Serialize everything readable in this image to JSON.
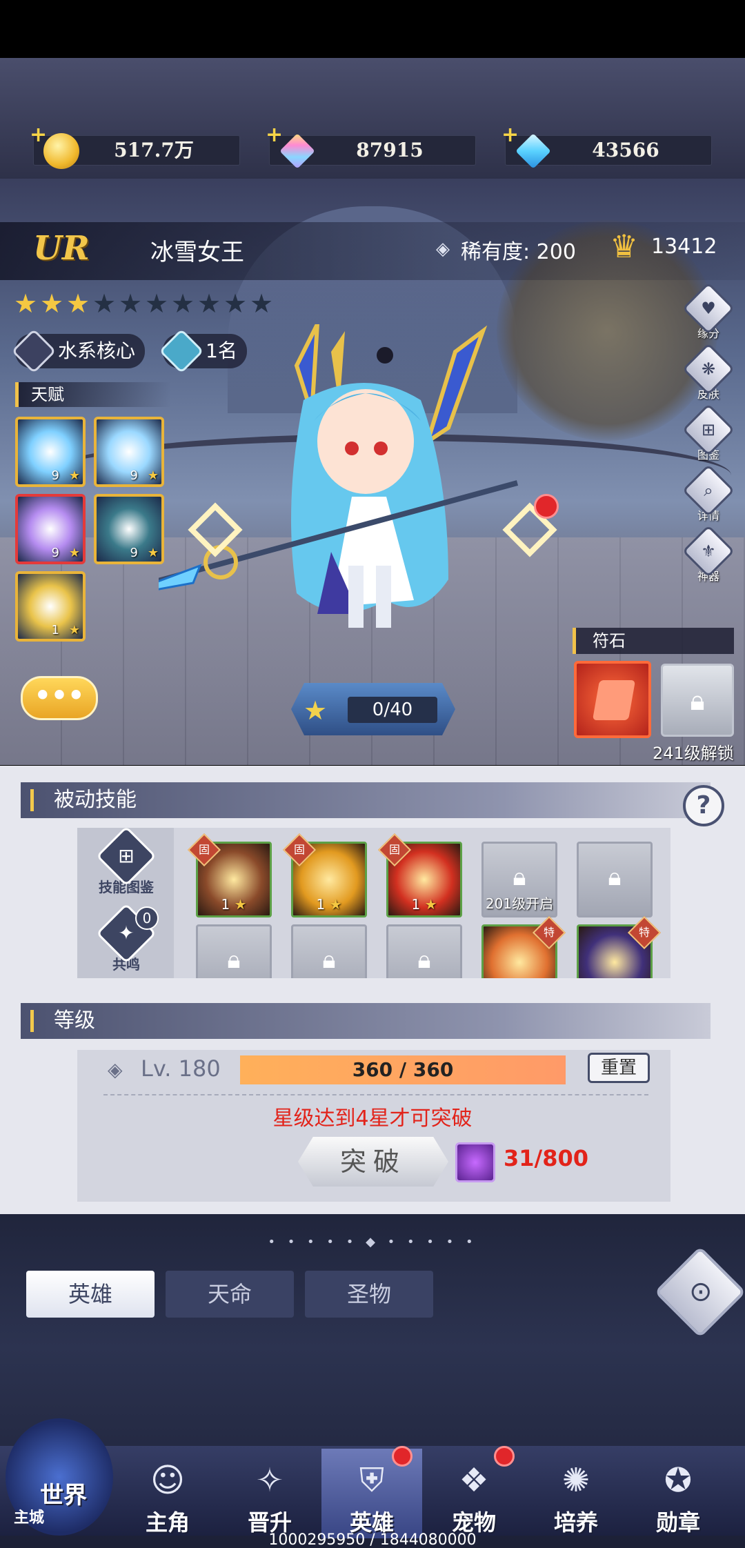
{
  "currencies": [
    {
      "name": "gold-coin-icon",
      "value": "517.7万",
      "color": "#f3c64a"
    },
    {
      "name": "rainbow-gem-icon",
      "value": "87915",
      "color": "#d9a8ff"
    },
    {
      "name": "blue-diamond-icon",
      "value": "43566",
      "color": "#5ad2ff"
    }
  ],
  "hero": {
    "grade": "UR",
    "name": "冰雪女王",
    "rarity_label": "稀有度:",
    "rarity_value": "200",
    "power": "13412",
    "stars_total": 10,
    "stars_filled": 3,
    "tag_role": "水系核心",
    "tag_rank": "1名"
  },
  "talent": {
    "title": "天赋",
    "items": [
      {
        "level": "9",
        "color": "#7fd0ff"
      },
      {
        "level": "9",
        "color": "#9ad8ff"
      },
      {
        "level": "9",
        "color": "#b58cf0"
      },
      {
        "level": "9",
        "color": "#3b7a8a"
      },
      {
        "level": "1",
        "color": "#e9c34a"
      }
    ]
  },
  "side_buttons": [
    {
      "label": "缘分",
      "icon": "heart-icon"
    },
    {
      "label": "皮肤",
      "icon": "hanger-icon"
    },
    {
      "label": "图鉴",
      "icon": "book-icon"
    },
    {
      "label": "详情",
      "icon": "magnifier-icon"
    },
    {
      "label": "神器",
      "icon": "artifact-icon"
    }
  ],
  "exp": {
    "value": "0/40"
  },
  "rune": {
    "title": "符石",
    "unlock_note": "241级解锁"
  },
  "passive": {
    "title": "被动技能",
    "side_buttons": [
      {
        "label": "技能图鉴"
      },
      {
        "label": "共鸣",
        "badge": "0"
      }
    ],
    "fixed_tag": "固",
    "special_tag": "特",
    "row1": [
      {
        "level": "1",
        "color": "#8a4a2a",
        "tag": "固"
      },
      {
        "level": "1",
        "color": "#e29a20",
        "tag": "固"
      },
      {
        "level": "1",
        "color": "#d23020",
        "tag": "固"
      },
      {
        "locked": true,
        "note": "201级开启"
      },
      {
        "locked": true,
        "note": ""
      }
    ],
    "row2": [
      {
        "locked": true
      },
      {
        "locked": true
      },
      {
        "locked": true
      },
      {
        "color": "#e07030",
        "tag": "特"
      },
      {
        "color": "#40307a",
        "tag": "特"
      }
    ]
  },
  "level": {
    "title": "等级",
    "label": "Lv. 180",
    "bar_text": "360 / 360",
    "bar_fraction": 1.0,
    "reset_label": "重置",
    "break_note": "星级达到4星才可突破",
    "break_label": "突破",
    "cost": "31/800"
  },
  "tabs": [
    {
      "label": "英雄",
      "active": true
    },
    {
      "label": "天命",
      "active": false
    },
    {
      "label": "圣物",
      "active": false
    }
  ],
  "nav": {
    "world_label": "世界",
    "city_label": "主城",
    "items": [
      {
        "label": "主角",
        "icon": "protagonist-icon",
        "active": false,
        "badge": false
      },
      {
        "label": "晋升",
        "icon": "promotion-icon",
        "active": false,
        "badge": false
      },
      {
        "label": "英雄",
        "icon": "hero-helmet-icon",
        "active": true,
        "badge": true
      },
      {
        "label": "宠物",
        "icon": "pet-icon",
        "active": false,
        "badge": true
      },
      {
        "label": "培养",
        "icon": "cultivate-icon",
        "active": false,
        "badge": false
      },
      {
        "label": "勋章",
        "icon": "medal-icon",
        "active": false,
        "badge": false
      }
    ]
  },
  "bottom_text": "1000295950 / 1844080000"
}
